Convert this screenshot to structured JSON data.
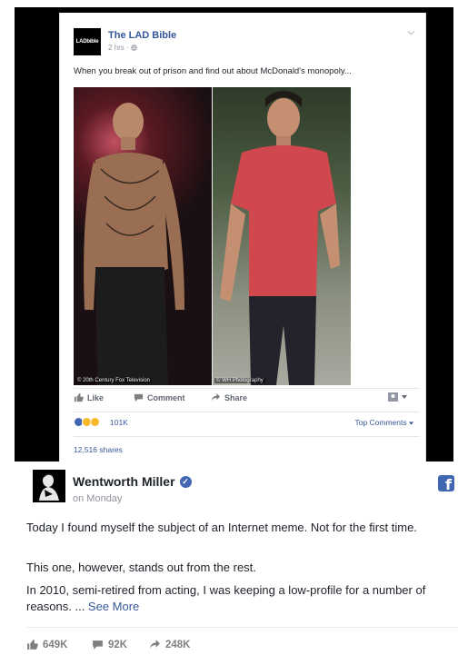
{
  "embedded_post": {
    "page_name": "The LAD Bible",
    "logo_text": "LADbible",
    "meta": "2 hrs · ",
    "text": "When you break out of prison and find out about McDonald's monopoly...",
    "photo_left_credit": "© 20th Century Fox Television",
    "photo_right_credit": "© WH Photography",
    "actions": {
      "like": "Like",
      "comment": "Comment",
      "share": "Share"
    },
    "reaction_count": "101K",
    "top_comments": "Top Comments ",
    "shares": "12,516 shares",
    "colors": {
      "link": "#365899",
      "like_blue": "#4267b2",
      "haha_yellow": "#f7b928"
    }
  },
  "main_post": {
    "author": "Wentworth Miller",
    "verified_icon": "✓",
    "time": "on Monday",
    "paragraphs": [
      "Today I found myself the subject of an Internet meme. Not for the first time.",
      "This one, however, stands out from the rest.",
      "In 2010, semi-retired from acting, I was keeping a low-profile for a number of reasons. ... "
    ],
    "see_more": "See More",
    "stats": {
      "likes": "649K",
      "comments": "92K",
      "shares": "248K"
    },
    "fb_logo": "f"
  }
}
